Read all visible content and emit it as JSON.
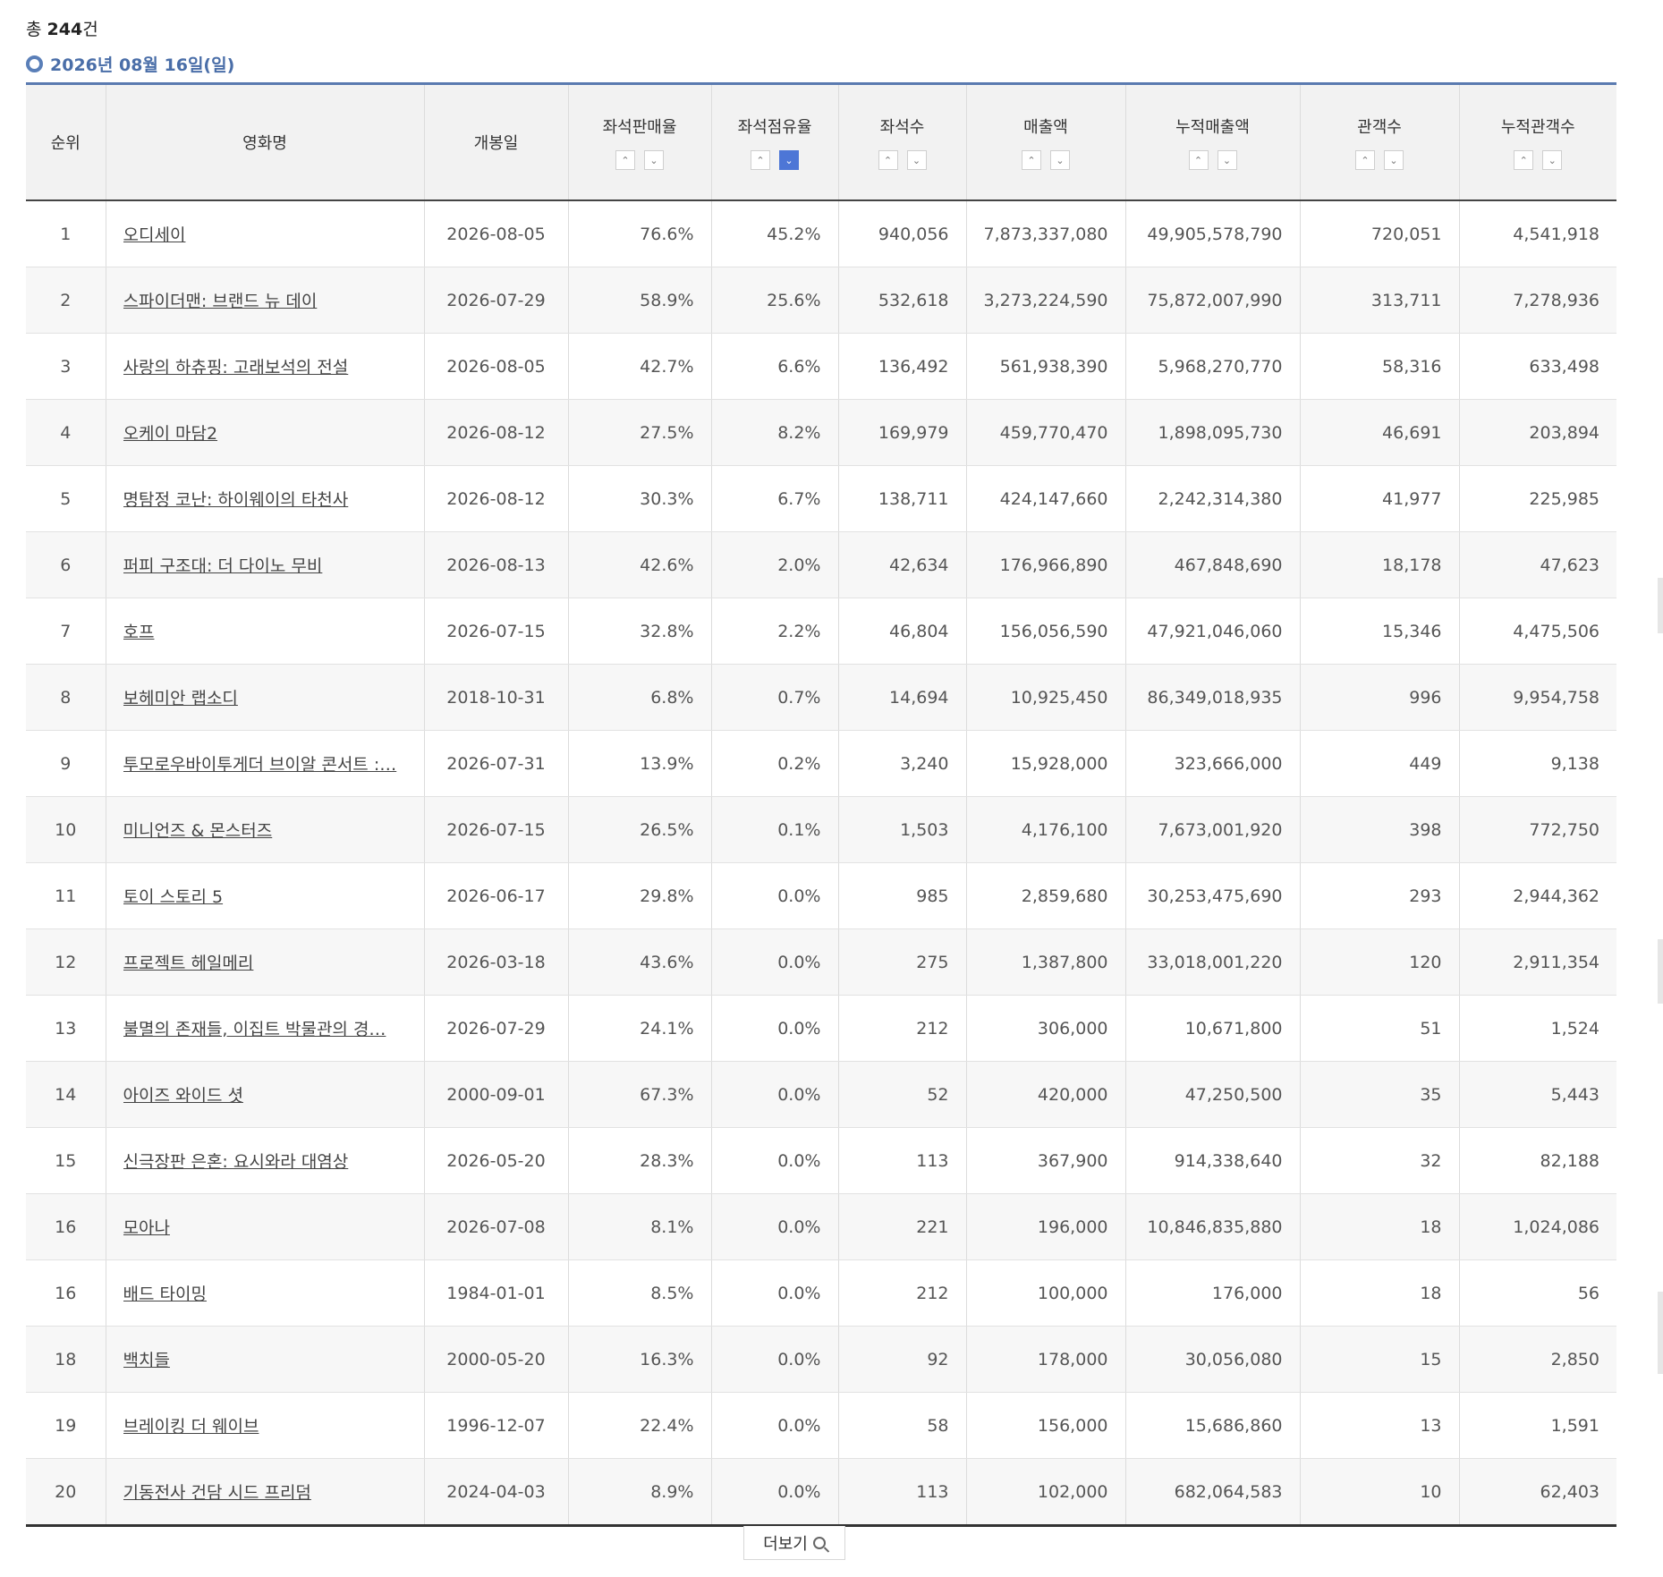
{
  "summary": {
    "prefix": "총 ",
    "count": "244",
    "suffix": "건"
  },
  "date_label": "2026년 08월 16일(일)",
  "columns": {
    "rank": "순위",
    "title": "영화명",
    "release": "개봉일",
    "seat_sales_rate": "좌석판매율",
    "seat_share": "좌석점유율",
    "seats": "좌석수",
    "revenue": "매출액",
    "cum_revenue": "누적매출액",
    "audience": "관객수",
    "cum_audience": "누적관객수"
  },
  "sort_icons": {
    "up": "chevron-up-icon",
    "down": "chevron-down-icon",
    "active": "seat_share-desc"
  },
  "rows": [
    [
      "1",
      "오디세이",
      "2026-08-05",
      "76.6%",
      "45.2%",
      "940,056",
      "7,873,337,080",
      "49,905,578,790",
      "720,051",
      "4,541,918"
    ],
    [
      "2",
      "스파이더맨: 브랜드 뉴 데이",
      "2026-07-29",
      "58.9%",
      "25.6%",
      "532,618",
      "3,273,224,590",
      "75,872,007,990",
      "313,711",
      "7,278,936"
    ],
    [
      "3",
      "사랑의 하츄핑: 고래보석의 전설",
      "2026-08-05",
      "42.7%",
      "6.6%",
      "136,492",
      "561,938,390",
      "5,968,270,770",
      "58,316",
      "633,498"
    ],
    [
      "4",
      "오케이 마담2",
      "2026-08-12",
      "27.5%",
      "8.2%",
      "169,979",
      "459,770,470",
      "1,898,095,730",
      "46,691",
      "203,894"
    ],
    [
      "5",
      "명탐정 코난: 하이웨이의 타천사",
      "2026-08-12",
      "30.3%",
      "6.7%",
      "138,711",
      "424,147,660",
      "2,242,314,380",
      "41,977",
      "225,985"
    ],
    [
      "6",
      "퍼피 구조대: 더 다이노 무비",
      "2026-08-13",
      "42.6%",
      "2.0%",
      "42,634",
      "176,966,890",
      "467,848,690",
      "18,178",
      "47,623"
    ],
    [
      "7",
      "호프",
      "2026-07-15",
      "32.8%",
      "2.2%",
      "46,804",
      "156,056,590",
      "47,921,046,060",
      "15,346",
      "4,475,506"
    ],
    [
      "8",
      "보헤미안 랩소디",
      "2018-10-31",
      "6.8%",
      "0.7%",
      "14,694",
      "10,925,450",
      "86,349,018,935",
      "996",
      "9,954,758"
    ],
    [
      "9",
      "투모로우바이투게더 브이알 콘서트 :…",
      "2026-07-31",
      "13.9%",
      "0.2%",
      "3,240",
      "15,928,000",
      "323,666,000",
      "449",
      "9,138"
    ],
    [
      "10",
      "미니언즈 & 몬스터즈",
      "2026-07-15",
      "26.5%",
      "0.1%",
      "1,503",
      "4,176,100",
      "7,673,001,920",
      "398",
      "772,750"
    ],
    [
      "11",
      "토이 스토리 5",
      "2026-06-17",
      "29.8%",
      "0.0%",
      "985",
      "2,859,680",
      "30,253,475,690",
      "293",
      "2,944,362"
    ],
    [
      "12",
      "프로젝트 헤일메리",
      "2026-03-18",
      "43.6%",
      "0.0%",
      "275",
      "1,387,800",
      "33,018,001,220",
      "120",
      "2,911,354"
    ],
    [
      "13",
      "불멸의 존재들, 이집트 박물관의 경…",
      "2026-07-29",
      "24.1%",
      "0.0%",
      "212",
      "306,000",
      "10,671,800",
      "51",
      "1,524"
    ],
    [
      "14",
      "아이즈 와이드 셧",
      "2000-09-01",
      "67.3%",
      "0.0%",
      "52",
      "420,000",
      "47,250,500",
      "35",
      "5,443"
    ],
    [
      "15",
      "신극장판 은혼: 요시와라 대염상",
      "2026-05-20",
      "28.3%",
      "0.0%",
      "113",
      "367,900",
      "914,338,640",
      "32",
      "82,188"
    ],
    [
      "16",
      "모아나",
      "2026-07-08",
      "8.1%",
      "0.0%",
      "221",
      "196,000",
      "10,846,835,880",
      "18",
      "1,024,086"
    ],
    [
      "16",
      "배드 타이밍",
      "1984-01-01",
      "8.5%",
      "0.0%",
      "212",
      "100,000",
      "176,000",
      "18",
      "56"
    ],
    [
      "18",
      "백치들",
      "2000-05-20",
      "16.3%",
      "0.0%",
      "92",
      "178,000",
      "30,056,080",
      "15",
      "2,850"
    ],
    [
      "19",
      "브레이킹 더 웨이브",
      "1996-12-07",
      "22.4%",
      "0.0%",
      "58",
      "156,000",
      "15,686,860",
      "13",
      "1,591"
    ],
    [
      "20",
      "기동전사 건담 시드 프리덤",
      "2024-04-03",
      "8.9%",
      "0.0%",
      "113",
      "102,000",
      "682,064,583",
      "10",
      "62,403"
    ]
  ],
  "more_button": "더보기"
}
